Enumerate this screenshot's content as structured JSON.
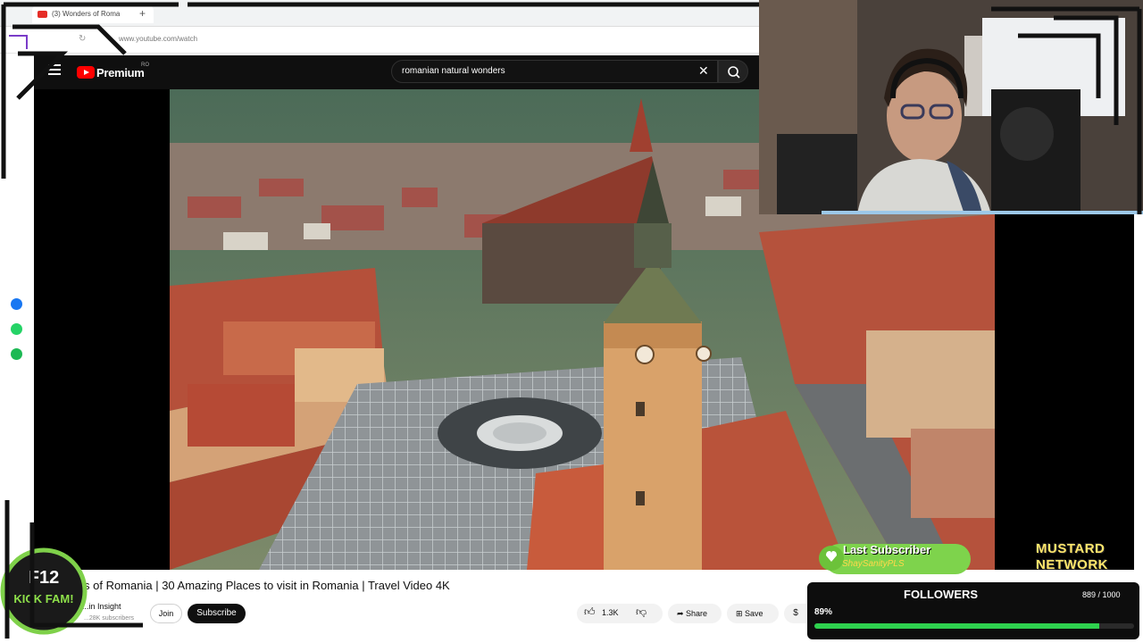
{
  "browser": {
    "tab_title": "(3) Wonders of Roma",
    "new_tab": "+",
    "url": "www.youtube.com/watch"
  },
  "youtube": {
    "brand": "Premium",
    "region": "RO",
    "search_query": "romanian natural wonders",
    "clear_icon": "✕"
  },
  "video": {
    "title": "s of Romania | 30 Amazing Places to visit in Romania | Travel Video 4K",
    "channel": "...in Insight",
    "subscribers": "...28K subscribers",
    "join_label": "Join",
    "subscribe_label": "Subscribe",
    "like_count": "1.3K",
    "share_label": "Share",
    "save_label": "Save"
  },
  "overlay": {
    "kick_line1": "F12",
    "kick_line2": "KICK FAM!",
    "last_sub_title": "Last Subscriber",
    "last_sub_name": "ShaySanityPLS",
    "network_line1": "MUSTARD",
    "network_line2": "NETWORK",
    "followers_title": "FOLLOWERS",
    "followers_count": "889 / 1000",
    "followers_percent": "89%",
    "followers_progress": 0.89
  },
  "colors": {
    "yt_red": "#ff0000",
    "progress_green": "#2ed14e",
    "header_dark": "#0f0f0f"
  },
  "icons": [
    "hamburger-icon",
    "youtube-logo-icon",
    "search-icon",
    "like-icon",
    "dislike-icon",
    "share-icon",
    "save-icon",
    "thanks-icon",
    "messenger-icon",
    "whatsapp-icon",
    "spotify-icon"
  ]
}
